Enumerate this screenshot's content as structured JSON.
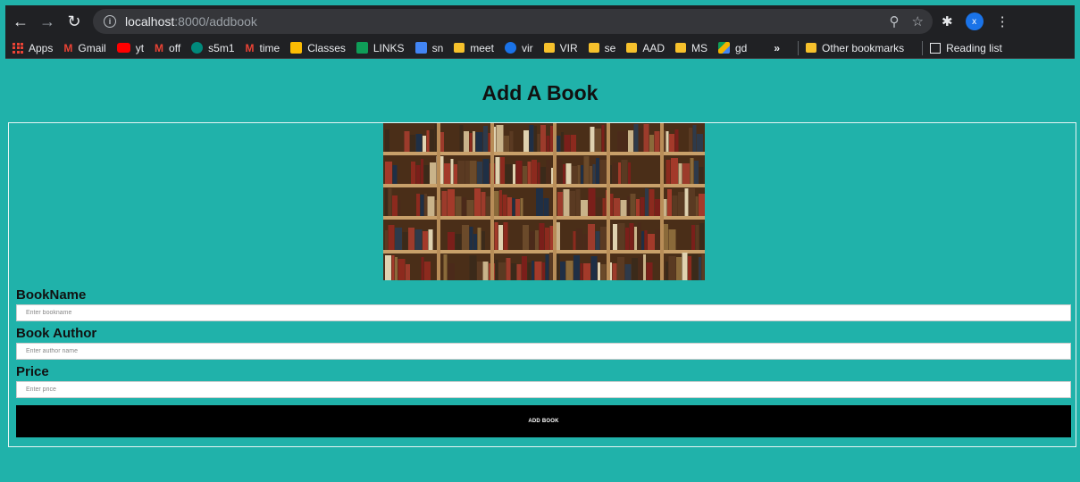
{
  "browser": {
    "url_host": "localhost",
    "url_path": ":8000/addbook",
    "profile_initial": "x"
  },
  "bookmarks": [
    {
      "label": "Apps",
      "icon": "apps-grid-icon"
    },
    {
      "label": "Gmail",
      "icon": "gmail-icon"
    },
    {
      "label": "yt",
      "icon": "youtube-icon"
    },
    {
      "label": "off",
      "icon": "gmail-icon"
    },
    {
      "label": "s5m1",
      "icon": "meet-icon"
    },
    {
      "label": "time",
      "icon": "gmail-icon"
    },
    {
      "label": "Classes",
      "icon": "classroom-icon"
    },
    {
      "label": "LINKS",
      "icon": "sheets-icon"
    },
    {
      "label": "sn",
      "icon": "docs-icon"
    },
    {
      "label": "meet",
      "icon": "folder-icon"
    },
    {
      "label": "vir",
      "icon": "c-icon"
    },
    {
      "label": "VIR",
      "icon": "folder-icon"
    },
    {
      "label": "se",
      "icon": "folder-icon"
    },
    {
      "label": "AAD",
      "icon": "folder-icon"
    },
    {
      "label": "MS",
      "icon": "folder-icon"
    },
    {
      "label": "gd",
      "icon": "drive-icon"
    }
  ],
  "bookmarks_overflow": "»",
  "other_bookmarks": "Other bookmarks",
  "reading_list": "Reading list",
  "page": {
    "title": "Add A Book",
    "fields": [
      {
        "label": "BookName",
        "placeholder": "Enter bookname",
        "value": ""
      },
      {
        "label": "Book Author",
        "placeholder": "Enter author name",
        "value": ""
      },
      {
        "label": "Price",
        "placeholder": "Enter price",
        "value": ""
      }
    ],
    "submit_label": "ADD BOOK"
  }
}
